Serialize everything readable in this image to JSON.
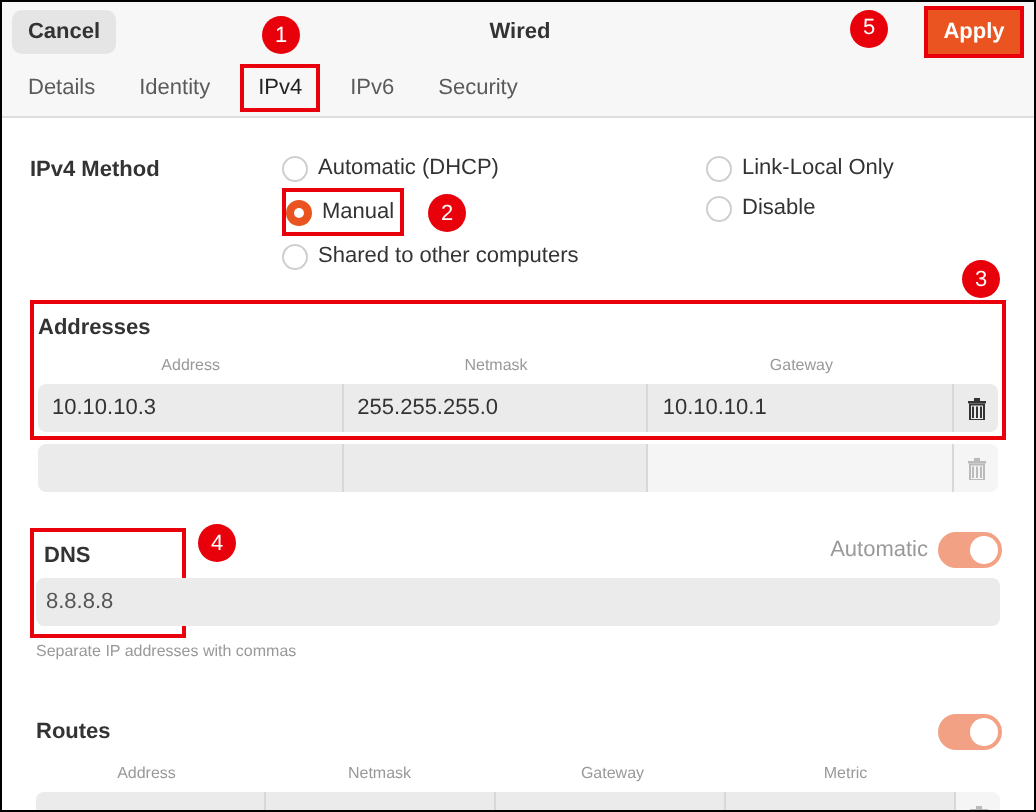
{
  "header": {
    "cancel": "Cancel",
    "title": "Wired",
    "apply": "Apply",
    "apply_annotation": "5"
  },
  "tabs": [
    {
      "label": "Details",
      "selected": false
    },
    {
      "label": "Identity",
      "selected": false
    },
    {
      "label": "IPv4",
      "selected": true,
      "annotation": "1"
    },
    {
      "label": "IPv6",
      "selected": false
    },
    {
      "label": "Security",
      "selected": false
    }
  ],
  "method": {
    "label": "IPv4 Method",
    "options": [
      {
        "label": "Automatic (DHCP)",
        "selected": false
      },
      {
        "label": "Manual",
        "selected": true,
        "annotation": "2"
      },
      {
        "label": "Shared to other computers",
        "selected": false
      },
      {
        "label": "Link-Local Only",
        "selected": false
      },
      {
        "label": "Disable",
        "selected": false
      }
    ]
  },
  "addresses": {
    "title": "Addresses",
    "annotation": "3",
    "columns": [
      "Address",
      "Netmask",
      "Gateway"
    ],
    "rows": [
      [
        "10.10.10.3",
        "255.255.255.0",
        "10.10.10.1"
      ],
      [
        "",
        "",
        ""
      ]
    ]
  },
  "dns": {
    "title": "DNS",
    "annotation": "4",
    "automatic_label": "Automatic",
    "automatic_on": true,
    "value": "8.8.8.8",
    "hint": "Separate IP addresses with commas"
  },
  "routes": {
    "title": "Routes",
    "automatic_on": true,
    "columns": [
      "Address",
      "Netmask",
      "Gateway",
      "Metric"
    ]
  }
}
